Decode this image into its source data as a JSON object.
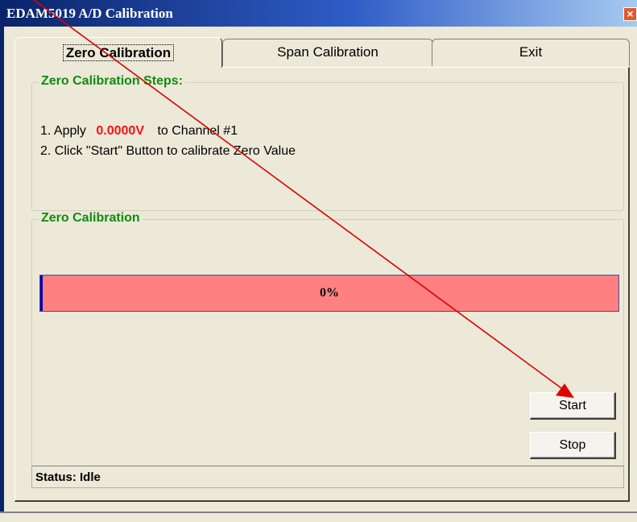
{
  "window": {
    "title": "EDAM5019 A/D Calibration",
    "close_glyph": "×"
  },
  "tabs": [
    {
      "label": "Zero Calibration",
      "active": true
    },
    {
      "label": "Span Calibration",
      "active": false
    },
    {
      "label": "Exit",
      "active": false
    }
  ],
  "steps_group": {
    "title": "Zero Calibration Steps:",
    "step1_prefix": "1. Apply",
    "step1_voltage": "0.0000V",
    "step1_suffix": "to Channel #1",
    "step2": "2. Click \"Start\" Button to calibrate Zero Value"
  },
  "calibration_group": {
    "title": "Zero Calibration",
    "progress_text": "0%",
    "progress_value": 0
  },
  "buttons": {
    "start_label": "Start",
    "stop_label": "Stop"
  },
  "status": {
    "text": "Status: Idle"
  },
  "colors": {
    "title_bar": "#0a246a",
    "group_title": "#118a11",
    "voltage": "#ff1010",
    "progress_background": "#ff8080",
    "annotation_arrow": "#e00000"
  },
  "icons": {
    "close": "close-icon",
    "annotation": "red-arrow-annotation"
  }
}
